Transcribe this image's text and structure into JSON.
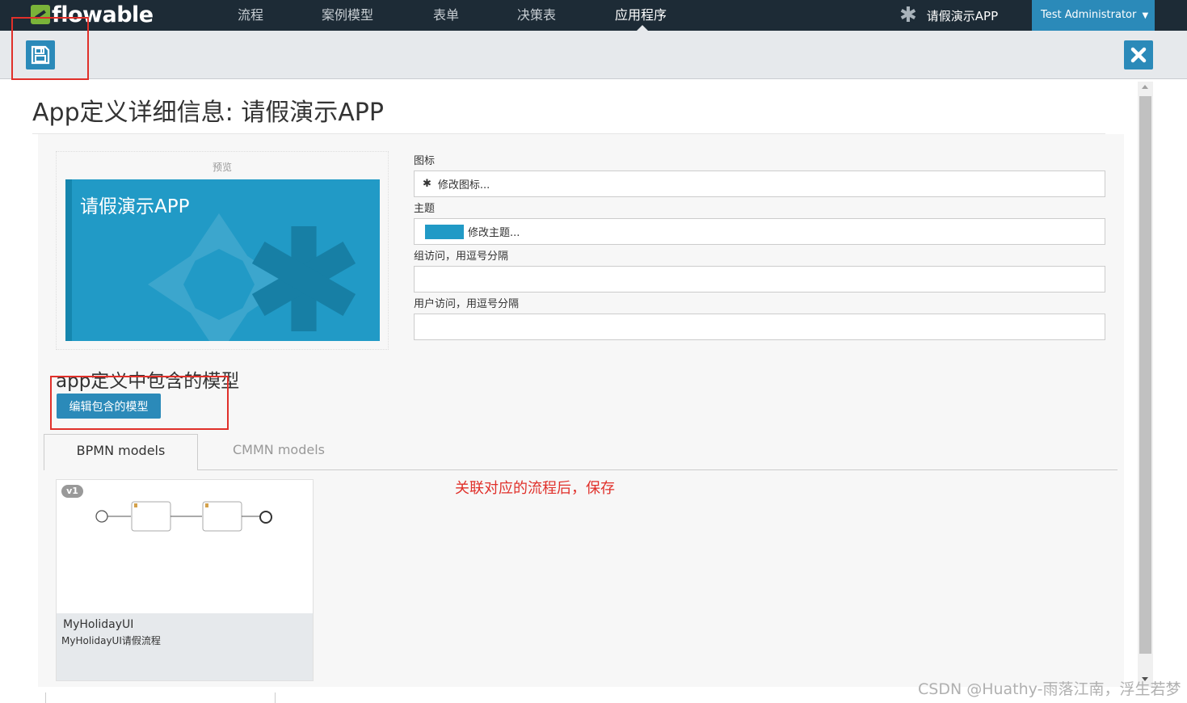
{
  "nav": {
    "logo": "flowable",
    "items": [
      {
        "label": "流程"
      },
      {
        "label": "案例模型"
      },
      {
        "label": "表单"
      },
      {
        "label": "决策表"
      },
      {
        "label": "应用程序"
      }
    ],
    "active_item": "应用程序",
    "app_name": "请假演示APP",
    "user": "Test Administrator"
  },
  "toolbar": {
    "save_icon": "floppy-disk-icon",
    "close_icon": "close-icon"
  },
  "page": {
    "title": "App定义详细信息: 请假演示APP"
  },
  "preview": {
    "label": "预览",
    "tile_title": "请假演示APP",
    "theme_color": "#219ac6"
  },
  "form": {
    "icon_label": "图标",
    "icon_button": "修改图标...",
    "theme_label": "主题",
    "theme_button": "修改主题...",
    "group_access_label": "组访问，用逗号分隔",
    "group_access_value": "",
    "user_access_label": "用户访问，用逗号分隔",
    "user_access_value": ""
  },
  "models_section": {
    "heading": "app定义中包含的模型",
    "edit_button": "编辑包含的模型",
    "tabs": [
      {
        "label": "BPMN models",
        "active": true
      },
      {
        "label": "CMMN models",
        "active": false
      }
    ],
    "cards": [
      {
        "version": "v1",
        "name": "MyHolidayUI",
        "description": "MyHolidayUI请假流程"
      }
    ]
  },
  "annotation": "关联对应的流程后，保存",
  "watermark": "CSDN @Huathy-雨落江南，浮生若梦",
  "colors": {
    "nav_bg": "#1d2b36",
    "accent": "#2b8ab9",
    "highlight": "#e0302a"
  }
}
